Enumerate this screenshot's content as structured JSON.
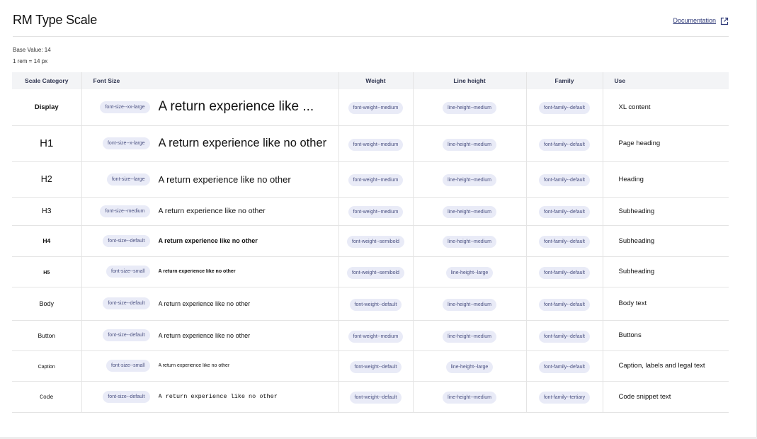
{
  "page": {
    "title": "RM Type Scale",
    "doc_link": "Documentation",
    "doc_icon": "external-link-icon",
    "base_value": "Base Value: 14",
    "rem_info": "1 rem = 14 px"
  },
  "table": {
    "headers": {
      "category": "Scale Category",
      "font_size": "Font Size",
      "weight": "Weight",
      "line_height": "Line height",
      "family": "Family",
      "use": "Use"
    },
    "rows": [
      {
        "category": "Display",
        "font_size": "font-size--xx-large",
        "sample": "A return experience like ...",
        "weight": "font-weight--medium",
        "line_height": "line-height--medium",
        "family": "font-family--default",
        "use": "XL content"
      },
      {
        "category": "H1",
        "font_size": "font-size--x-large",
        "sample": "A return experience like no other",
        "weight": "font-weight--medium",
        "line_height": "line-height--medium",
        "family": "font-family--default",
        "use": "Page heading"
      },
      {
        "category": "H2",
        "font_size": "font-size--large",
        "sample": "A return experience like no other",
        "weight": "font-weight--medium",
        "line_height": "line-height--medium",
        "family": "font-family--default",
        "use": "Heading"
      },
      {
        "category": "H3",
        "font_size": "font-size--medium",
        "sample": "A return experience like no other",
        "weight": "font-weight--medium",
        "line_height": "line-height--medium",
        "family": "font-family--default",
        "use": "Subheading"
      },
      {
        "category": "H4",
        "font_size": "font-size--default",
        "sample": "A return experience like no other",
        "weight": "font-weight--semibold",
        "line_height": "line-height--medium",
        "family": "font-family--default",
        "use": "Subheading"
      },
      {
        "category": "H5",
        "font_size": "font-size--small",
        "sample": "A return experience like no other",
        "weight": "font-weight--semibold",
        "line_height": "line-height--large",
        "family": "font-family--default",
        "use": "Subheading"
      },
      {
        "category": "Body",
        "font_size": "font-size--default",
        "sample": "A return experience like no other",
        "weight": "font-weight--default",
        "line_height": "line-height--medium",
        "family": "font-family--default",
        "use": "Body text"
      },
      {
        "category": "Button",
        "font_size": "font-size--default",
        "sample": "A return experience like no other",
        "weight": "font-weight--medium",
        "line_height": "line-height--medium",
        "family": "font-family--default",
        "use": "Buttons"
      },
      {
        "category": "Caption",
        "font_size": "font-size--small",
        "sample": "A return experience like no other",
        "weight": "font-weight--default",
        "line_height": "line-height--large",
        "family": "font-family--default",
        "use": "Caption, labels and legal text"
      },
      {
        "category": "Code",
        "font_size": "font-size--default",
        "sample": "A return experience like no other",
        "weight": "font-weight--default",
        "line_height": "line-height--medium",
        "family": "font-family--tertiary",
        "use": "Code snippet text"
      }
    ]
  },
  "colors": {
    "chip_bg": "#e9ebf7",
    "chip_text": "#4a5080",
    "link": "#2f3a78",
    "header_bg": "#f3f4f6"
  }
}
